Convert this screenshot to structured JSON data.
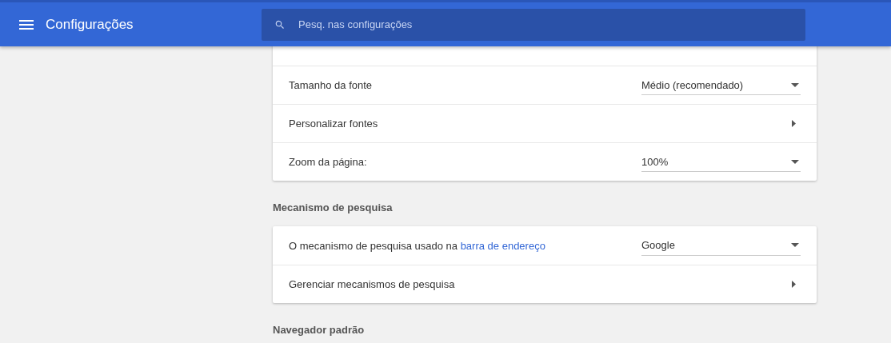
{
  "header": {
    "title": "Configurações",
    "search": {
      "placeholder": "Pesq. nas configurações"
    }
  },
  "sections": [
    {
      "rows": [
        {
          "kind": "dropdown",
          "label": "Tamanho da fonte",
          "value": "Médio (recomendado)"
        },
        {
          "kind": "link",
          "label": "Personalizar fontes"
        },
        {
          "kind": "dropdown",
          "label": "Zoom da página:",
          "value": "100%"
        }
      ]
    },
    {
      "heading": "Mecanismo de pesquisa",
      "rows": [
        {
          "kind": "dropdown",
          "label": "O mecanismo de pesquisa usado na",
          "link": "barra de endereço",
          "value": "Google"
        },
        {
          "kind": "link",
          "label": "Gerenciar mecanismos de pesquisa"
        }
      ]
    },
    {
      "heading": "Navegador padrão"
    }
  ]
}
